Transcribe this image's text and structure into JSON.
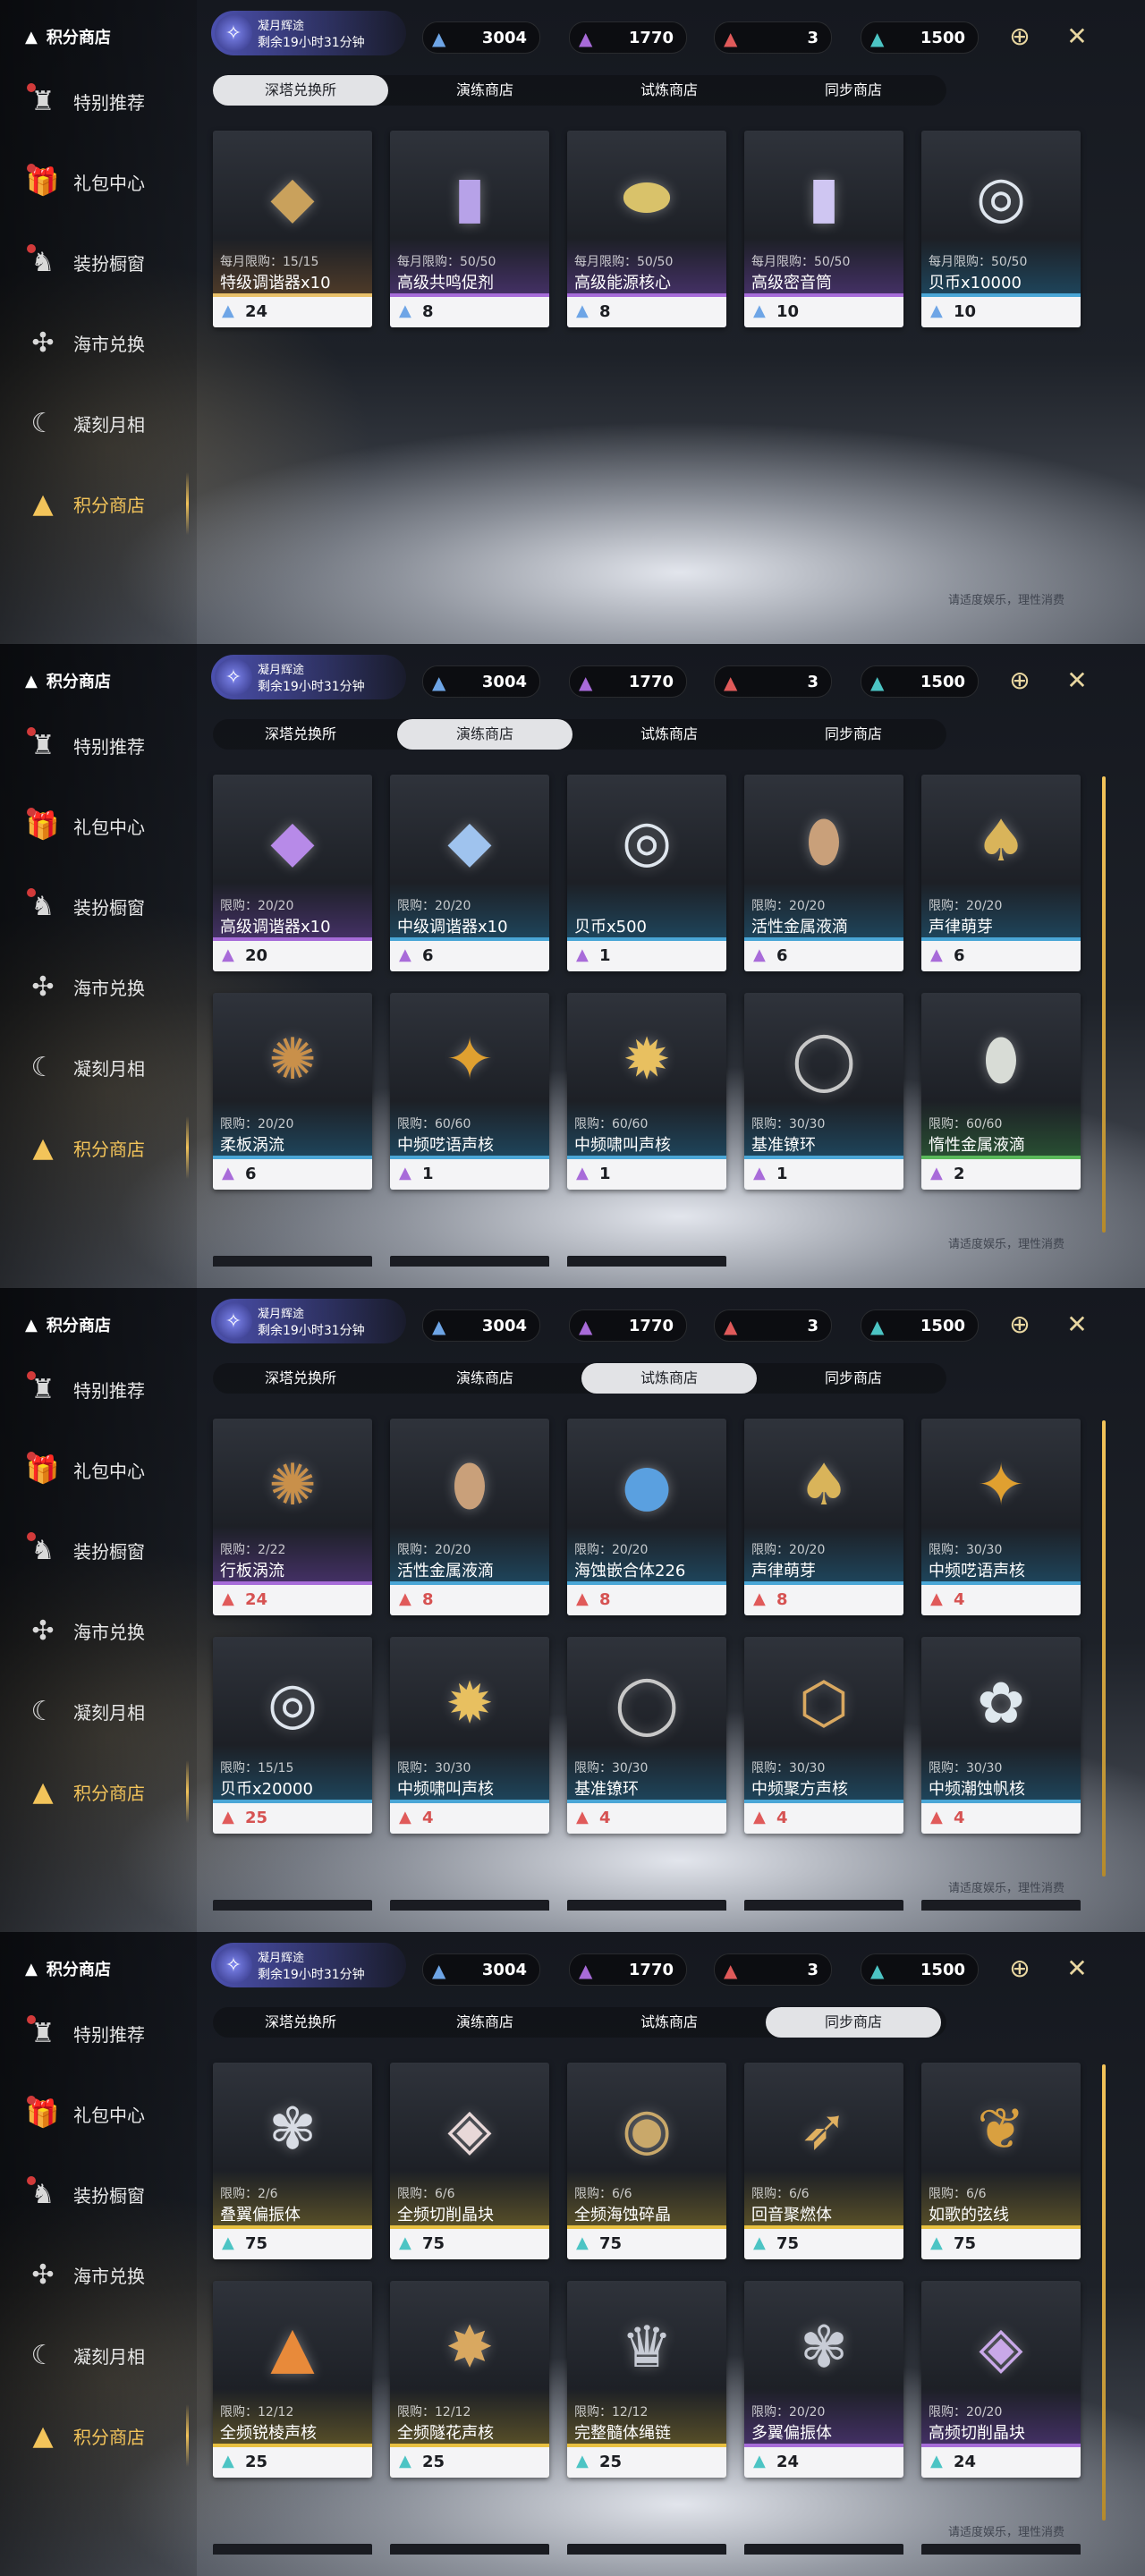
{
  "sidebar": {
    "title": "积分商店",
    "items": [
      {
        "label": "特别推荐",
        "icon": "recommend-icon",
        "badge": true
      },
      {
        "label": "礼包中心",
        "icon": "gift-icon",
        "badge": true
      },
      {
        "label": "装扮橱窗",
        "icon": "wardrobe-icon",
        "badge": true
      },
      {
        "label": "海市兑换",
        "icon": "exchange-icon",
        "badge": false
      },
      {
        "label": "凝刻月相",
        "icon": "moon-phase-icon",
        "badge": false
      },
      {
        "label": "积分商店",
        "icon": "points-shop-icon",
        "badge": false,
        "active": true
      }
    ]
  },
  "event": {
    "line1": "凝月辉途",
    "line2": "剩余19小时31分钟"
  },
  "currencies": [
    {
      "value": "3004",
      "icon": "blue-crystal-icon"
    },
    {
      "value": "1770",
      "icon": "purple-crystal-icon"
    },
    {
      "value": "3",
      "icon": "red-crystal-icon"
    },
    {
      "value": "1500",
      "icon": "teal-crystal-icon"
    }
  ],
  "tabs": [
    "深塔兑换所",
    "演练商店",
    "试炼商店",
    "同步商店"
  ],
  "tip": "请适度娱乐，理性消费",
  "panels": [
    {
      "selected_tab": 0,
      "rows": [
        [
          {
            "limit": "每月限购：15/15",
            "name": "特级调谐器x10",
            "price": "24",
            "gem": "b",
            "color": "#6a4a2a",
            "color2": "#e8c06a",
            "art": "◆",
            "artc": "#c9a15c"
          },
          {
            "limit": "每月限购：50/50",
            "name": "高级共鸣促剂",
            "price": "8",
            "gem": "b",
            "color": "#5a3a8a",
            "color2": "#a66cd8",
            "art": "▮",
            "artc": "#b7a2e8"
          },
          {
            "limit": "每月限购：50/50",
            "name": "高级能源核心",
            "price": "8",
            "gem": "b",
            "color": "#5a3a8a",
            "color2": "#a66cd8",
            "art": "⬬",
            "artc": "#d9c26a"
          },
          {
            "limit": "每月限购：50/50",
            "name": "高级密音筒",
            "price": "10",
            "gem": "b",
            "color": "#5a3a8a",
            "color2": "#a66cd8",
            "art": "▮",
            "artc": "#cfc6f2"
          },
          {
            "limit": "每月限购：50/50",
            "name": "贝币x10000",
            "price": "10",
            "gem": "b",
            "color": "#1f5a7a",
            "color2": "#4aa6d6",
            "art": "◎",
            "artc": "#dfe6ee"
          }
        ]
      ],
      "stubs": 0
    },
    {
      "selected_tab": 1,
      "rows": [
        [
          {
            "limit": "限购：20/20",
            "name": "高级调谐器x10",
            "price": "20",
            "gem": "p",
            "color": "#5a3a8a",
            "color2": "#a66cd8",
            "art": "◆",
            "artc": "#b78ae8"
          },
          {
            "limit": "限购：20/20",
            "name": "中级调谐器x10",
            "price": "6",
            "gem": "p",
            "color": "#1f5a7a",
            "color2": "#4aa6d6",
            "art": "◆",
            "artc": "#9fc3ee"
          },
          {
            "limit": "",
            "name": "贝币x500",
            "price": "1",
            "gem": "p",
            "color": "#1f5a7a",
            "color2": "#4aa6d6",
            "art": "◎",
            "artc": "#dfe6ee"
          },
          {
            "limit": "限购：20/20",
            "name": "活性金属液滴",
            "price": "6",
            "gem": "p",
            "color": "#1f5a7a",
            "color2": "#4aa6d6",
            "art": "⬮",
            "artc": "#c9a07a"
          },
          {
            "limit": "限购：20/20",
            "name": "声律萌芽",
            "price": "6",
            "gem": "p",
            "color": "#1f5a7a",
            "color2": "#4aa6d6",
            "art": "♠",
            "artc": "#d9b45a"
          }
        ],
        [
          {
            "limit": "限购：20/20",
            "name": "柔板涡流",
            "price": "6",
            "gem": "p",
            "color": "#1f5a7a",
            "color2": "#4aa6d6",
            "art": "✺",
            "artc": "#c9904a"
          },
          {
            "limit": "限购：60/60",
            "name": "中频呓语声核",
            "price": "1",
            "gem": "p",
            "color": "#1f5a7a",
            "color2": "#4aa6d6",
            "art": "✦",
            "artc": "#e0a030"
          },
          {
            "limit": "限购：60/60",
            "name": "中频啸叫声核",
            "price": "1",
            "gem": "p",
            "color": "#1f5a7a",
            "color2": "#4aa6d6",
            "art": "✹",
            "artc": "#e8c060"
          },
          {
            "limit": "限购：30/30",
            "name": "基准镣环",
            "price": "1",
            "gem": "p",
            "color": "#1f5a7a",
            "color2": "#4aa6d6",
            "art": "◯",
            "artc": "#c8c8c8"
          },
          {
            "limit": "限购：60/60",
            "name": "惰性金属液滴",
            "price": "2",
            "gem": "p",
            "color": "#2f6a3a",
            "color2": "#5ab85a",
            "art": "⬮",
            "artc": "#d8dcd6"
          }
        ]
      ],
      "stubs": 3
    },
    {
      "selected_tab": 2,
      "rows": [
        [
          {
            "limit": "限购：2/22",
            "name": "行板涡流",
            "price": "24",
            "gem": "r",
            "color": "#5a3a8a",
            "color2": "#a66cd8",
            "art": "✺",
            "artc": "#c9904a"
          },
          {
            "limit": "限购：20/20",
            "name": "活性金属液滴",
            "price": "8",
            "gem": "r",
            "color": "#1f5a7a",
            "color2": "#4aa6d6",
            "art": "⬮",
            "artc": "#c9a07a"
          },
          {
            "limit": "限购：20/20",
            "name": "海蚀嵌合体226",
            "price": "8",
            "gem": "r",
            "color": "#1f5a7a",
            "color2": "#4aa6d6",
            "art": "●",
            "artc": "#5aa0e0"
          },
          {
            "limit": "限购：20/20",
            "name": "声律萌芽",
            "price": "8",
            "gem": "r",
            "color": "#1f5a7a",
            "color2": "#4aa6d6",
            "art": "♠",
            "artc": "#d9b45a"
          },
          {
            "limit": "限购：30/30",
            "name": "中频呓语声核",
            "price": "4",
            "gem": "r",
            "color": "#1f5a7a",
            "color2": "#4aa6d6",
            "art": "✦",
            "artc": "#e0a030"
          }
        ],
        [
          {
            "limit": "限购：15/15",
            "name": "贝币x20000",
            "price": "25",
            "gem": "r",
            "color": "#1f5a7a",
            "color2": "#4aa6d6",
            "art": "◎",
            "artc": "#dfe6ee"
          },
          {
            "limit": "限购：30/30",
            "name": "中频啸叫声核",
            "price": "4",
            "gem": "r",
            "color": "#1f5a7a",
            "color2": "#4aa6d6",
            "art": "✹",
            "artc": "#e8c060"
          },
          {
            "limit": "限购：30/30",
            "name": "基准镣环",
            "price": "4",
            "gem": "r",
            "color": "#1f5a7a",
            "color2": "#4aa6d6",
            "art": "◯",
            "artc": "#c8c8c8"
          },
          {
            "limit": "限购：30/30",
            "name": "中频聚方声核",
            "price": "4",
            "gem": "r",
            "color": "#1f5a7a",
            "color2": "#4aa6d6",
            "art": "⬡",
            "artc": "#d9a860"
          },
          {
            "limit": "限购：30/30",
            "name": "中频潮蚀帆核",
            "price": "4",
            "gem": "r",
            "color": "#1f5a7a",
            "color2": "#4aa6d6",
            "art": "✿",
            "artc": "#dfe8ee"
          }
        ]
      ],
      "stubs": 5
    },
    {
      "selected_tab": 3,
      "rows": [
        [
          {
            "limit": "限购：2/6",
            "name": "叠翼偏振体",
            "price": "75",
            "gem": "t",
            "color": "#7a6a2a",
            "color2": "#e8c040",
            "art": "✾",
            "artc": "#d8dce4"
          },
          {
            "limit": "限购：6/6",
            "name": "全频切削晶块",
            "price": "75",
            "gem": "t",
            "color": "#7a6a2a",
            "color2": "#e8c040",
            "art": "◈",
            "artc": "#e8d8d8"
          },
          {
            "limit": "限购：6/6",
            "name": "全频海蚀碎晶",
            "price": "75",
            "gem": "t",
            "color": "#7a6a2a",
            "color2": "#e8c040",
            "art": "◉",
            "artc": "#c9a86a"
          },
          {
            "limit": "限购：6/6",
            "name": "回音聚燃体",
            "price": "75",
            "gem": "t",
            "color": "#7a6a2a",
            "color2": "#e8c040",
            "art": "➶",
            "artc": "#e0b060"
          },
          {
            "limit": "限购：6/6",
            "name": "如歌的弦线",
            "price": "75",
            "gem": "t",
            "color": "#7a6a2a",
            "color2": "#e8c040",
            "art": "❦",
            "artc": "#d9a040"
          }
        ],
        [
          {
            "limit": "限购：12/12",
            "name": "全频锐棱声核",
            "price": "25",
            "gem": "t",
            "color": "#7a6a2a",
            "color2": "#e8c040",
            "art": "▲",
            "artc": "#e88a3a"
          },
          {
            "limit": "限购：12/12",
            "name": "全频隧花声核",
            "price": "25",
            "gem": "t",
            "color": "#7a6a2a",
            "color2": "#e8c040",
            "art": "✸",
            "artc": "#d9a860"
          },
          {
            "limit": "限购：12/12",
            "name": "完整髓体绳链",
            "price": "25",
            "gem": "t",
            "color": "#7a6a2a",
            "color2": "#e8c040",
            "art": "♛",
            "artc": "#c8ccd6"
          },
          {
            "limit": "限购：20/20",
            "name": "多翼偏振体",
            "price": "24",
            "gem": "t",
            "color": "#5a3a8a",
            "color2": "#a66cd8",
            "art": "✾",
            "artc": "#c8ccd6"
          },
          {
            "limit": "限购：20/20",
            "name": "高频切削晶块",
            "price": "24",
            "gem": "t",
            "color": "#5a3a8a",
            "color2": "#a66cd8",
            "art": "◈",
            "artc": "#c9a8e8"
          }
        ]
      ],
      "stubs": 5
    }
  ]
}
